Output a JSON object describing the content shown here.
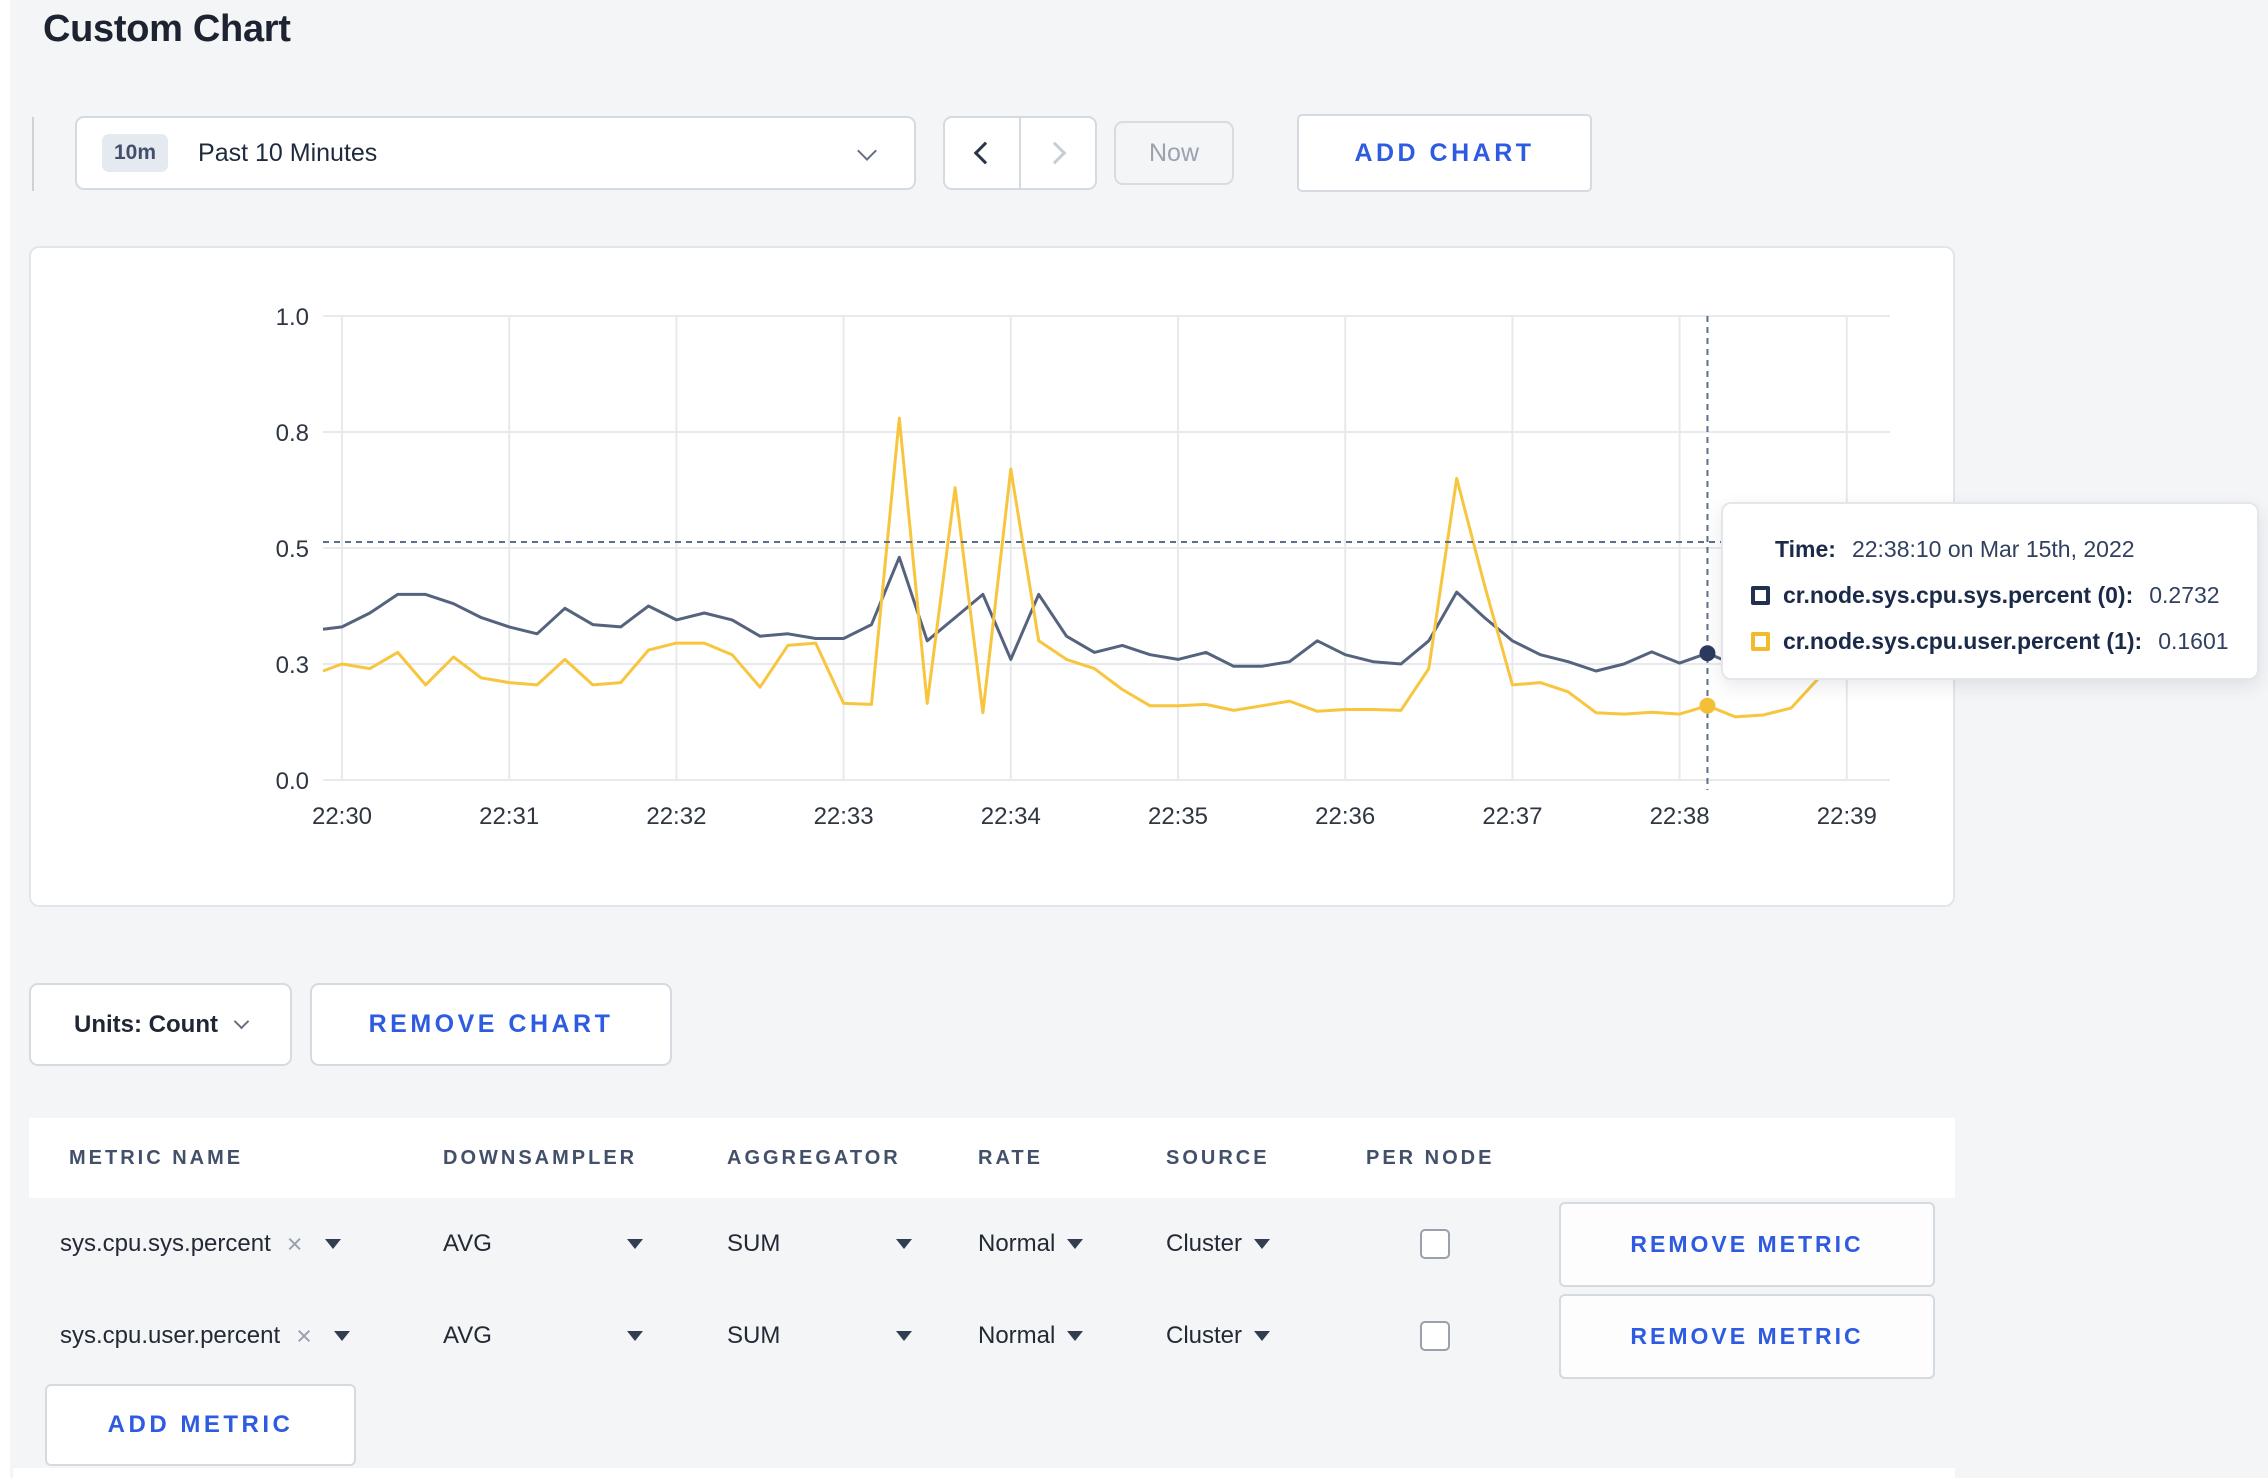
{
  "colors": {
    "accent": "#2e5be0",
    "page_bg": "#f4f5f7",
    "series_sys": "#56637f",
    "series_user": "#f8c53f"
  },
  "page": {
    "title": "Custom Chart"
  },
  "toolbar": {
    "time_badge": "10m",
    "time_label": "Past 10 Minutes",
    "now_label": "Now",
    "add_chart_label": "ADD CHART"
  },
  "chart_data": {
    "type": "line",
    "title": "",
    "xlabel": "",
    "ylabel": "",
    "ylim": [
      0,
      1
    ],
    "grid": true,
    "grid_color": "#e7e9ed",
    "axis_text_color": "#2e3642",
    "x_ticks": [
      "22:30",
      "22:31",
      "22:32",
      "22:33",
      "22:34",
      "22:35",
      "22:36",
      "22:37",
      "22:38",
      "22:39"
    ],
    "y_ticks": [
      {
        "label": "0.0",
        "value": 0
      },
      {
        "label": "0.3",
        "value": 0.25
      },
      {
        "label": "0.5",
        "value": 0.5
      },
      {
        "label": "0.8",
        "value": 0.75
      },
      {
        "label": "1.0",
        "value": 1.0
      }
    ],
    "start_time": "22:29:50",
    "interval_seconds": 10,
    "series": [
      {
        "name": "cr.node.sys.cpu.sys.percent",
        "color": "#56637f",
        "dot_color": "#2b3a5e",
        "values": [
          0.325,
          0.33,
          0.36,
          0.4,
          0.4,
          0.38,
          0.35,
          0.33,
          0.315,
          0.37,
          0.335,
          0.33,
          0.375,
          0.345,
          0.36,
          0.345,
          0.31,
          0.315,
          0.305,
          0.305,
          0.335,
          0.48,
          0.3,
          0.35,
          0.4,
          0.26,
          0.4,
          0.31,
          0.275,
          0.29,
          0.27,
          0.26,
          0.275,
          0.245,
          0.245,
          0.255,
          0.3,
          0.27,
          0.255,
          0.25,
          0.3,
          0.405,
          0.35,
          0.3,
          0.27,
          0.255,
          0.235,
          0.25,
          0.276,
          0.252,
          0.2732,
          0.248,
          0.26,
          0.27,
          0.26,
          0.25,
          0.252,
          0.26
        ]
      },
      {
        "name": "cr.node.sys.cpu.user.percent",
        "color": "#f8c53f",
        "dot_color": "#f3bf37",
        "values": [
          0.235,
          0.25,
          0.24,
          0.275,
          0.205,
          0.265,
          0.22,
          0.21,
          0.205,
          0.26,
          0.205,
          0.21,
          0.28,
          0.295,
          0.295,
          0.27,
          0.2,
          0.29,
          0.295,
          0.165,
          0.163,
          0.78,
          0.165,
          0.63,
          0.145,
          0.67,
          0.3,
          0.26,
          0.24,
          0.195,
          0.16,
          0.16,
          0.163,
          0.15,
          0.16,
          0.17,
          0.148,
          0.152,
          0.152,
          0.15,
          0.24,
          0.65,
          0.42,
          0.205,
          0.21,
          0.19,
          0.145,
          0.142,
          0.146,
          0.142,
          0.1601,
          0.136,
          0.14,
          0.155,
          0.22,
          0.285,
          0.23,
          0.27
        ]
      }
    ],
    "crosshair": {
      "index": 50,
      "time": "22:38:10",
      "y_value": 0.513,
      "color": "#5e7089"
    },
    "highlight": [
      {
        "series": 0,
        "value": 0.2732
      },
      {
        "series": 1,
        "value": 0.1601
      }
    ]
  },
  "tooltip": {
    "time_label": "Time:",
    "time_value": "22:38:10 on Mar 15th, 2022",
    "rows": [
      {
        "name": "cr.node.sys.cpu.sys.percent (0):",
        "value": "0.2732",
        "color": "#22304f"
      },
      {
        "name": "cr.node.sys.cpu.user.percent (1):",
        "value": "0.1601",
        "color": "#f2bb2b"
      }
    ]
  },
  "chart_footer": {
    "units_label": "Units: Count",
    "remove_chart_label": "REMOVE CHART"
  },
  "metrics_table": {
    "headers": [
      "METRIC NAME",
      "DOWNSAMPLER",
      "AGGREGATOR",
      "RATE",
      "SOURCE",
      "PER NODE"
    ],
    "rows": [
      {
        "metric": "sys.cpu.sys.percent",
        "downsampler": "AVG",
        "aggregator": "SUM",
        "rate": "Normal",
        "source": "Cluster",
        "per_node_checked": false,
        "remove_label": "REMOVE METRIC"
      },
      {
        "metric": "sys.cpu.user.percent",
        "downsampler": "AVG",
        "aggregator": "SUM",
        "rate": "Normal",
        "source": "Cluster",
        "per_node_checked": false,
        "remove_label": "REMOVE METRIC"
      }
    ],
    "add_metric_label": "ADD METRIC"
  }
}
